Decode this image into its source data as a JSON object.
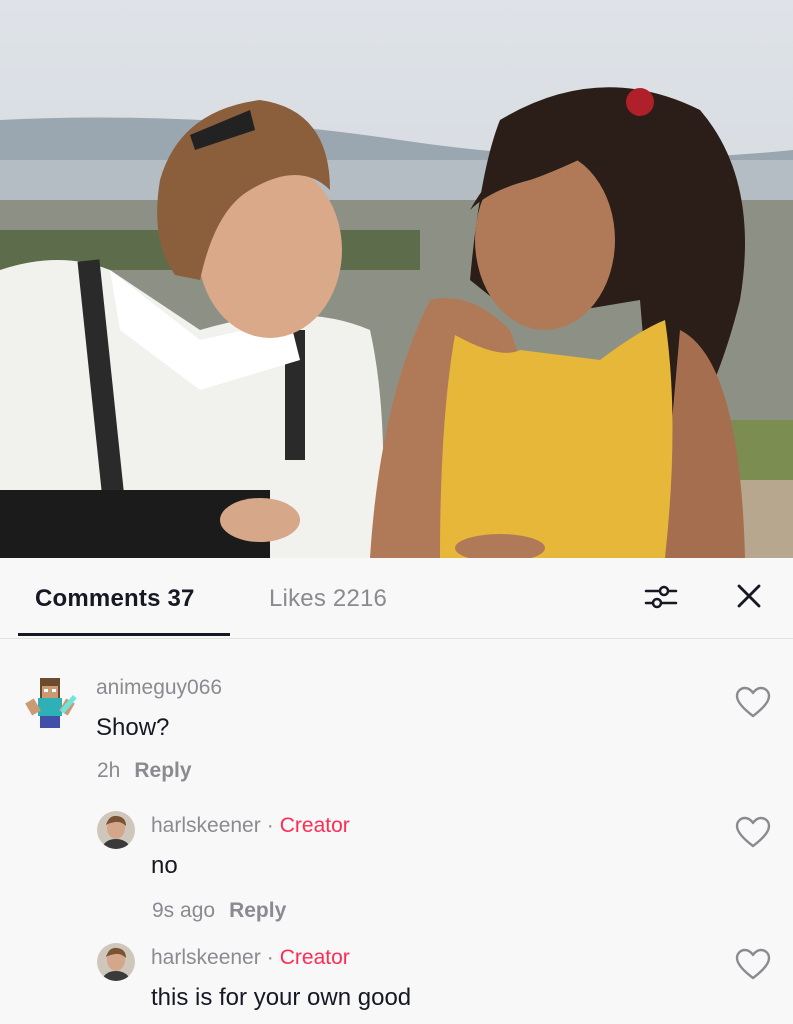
{
  "tabs": {
    "comments_label": "Comments 37",
    "likes_label": "Likes 2216"
  },
  "icons": {
    "filter": "filter-sliders-icon",
    "close": "close-icon",
    "like": "heart-outline-icon"
  },
  "comments": [
    {
      "username": "animeguy066",
      "text": "Show?",
      "time": "2h",
      "reply_label": "Reply"
    },
    {
      "username": "harlskeener",
      "badge": "Creator",
      "text": "no",
      "time": "9s ago",
      "reply_label": "Reply"
    },
    {
      "username": "harlskeener",
      "badge": "Creator",
      "text": "this is for your own good"
    }
  ],
  "colors": {
    "creator_badge": "#fe2c55",
    "text_primary": "#161823",
    "text_secondary": "#8a8b91",
    "panel_background": "#f8f8f8"
  }
}
